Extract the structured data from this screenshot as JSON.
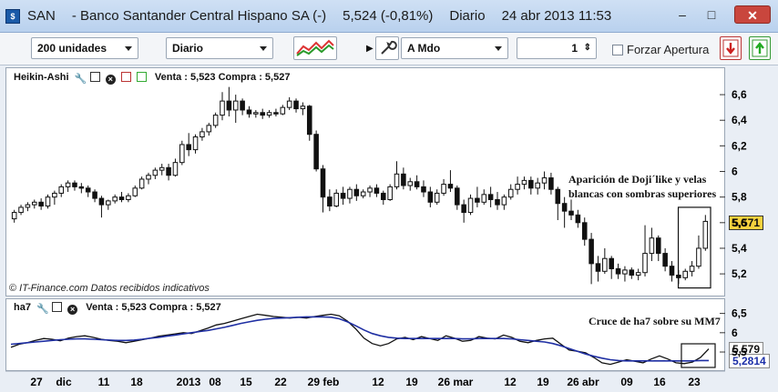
{
  "window": {
    "ticker": "SAN",
    "name": "- Banco Santander Central Hispano SA (-)",
    "price": "5,524 (-0,81%)",
    "period": "Diario",
    "datetime": "24 abr 2013 11:53",
    "minimize": "–",
    "maximize": "□",
    "close": "✕"
  },
  "toolbar": {
    "units_select": "200 unidades",
    "period_select": "Diario",
    "order_type_select": "A Mdo",
    "quantity_value": "1",
    "quantity_arrows": "⇕",
    "force_open_label": "Forzar Apertura",
    "force_open_checked": false,
    "icons": [
      "chart-style-icon",
      "wrench-icon",
      "sell-icon",
      "buy-icon"
    ]
  },
  "main_panel": {
    "title": "Heikin-Ashi",
    "quote": "Venta : 5,523 Compra : 5,527",
    "credit_prefix": "©",
    "credit_company": "IT-Finance.com",
    "credit_note": "Datos recibidos indicativos",
    "last_price_tag": "5,571",
    "annotation_line1": "Aparición de Doji´like y velas",
    "annotation_line2": "blancas con sombras superiores"
  },
  "indicator_panel": {
    "title": "ha7",
    "quote": "Venta : 5,523 Compra : 5,527",
    "tag_ha7": "5,579",
    "tag_mm7": "5,2814",
    "annotation": "Cruce de ha7 sobre su MM7"
  },
  "colors": {
    "bear_candle": "#111111",
    "bull_candle": "#ffffff",
    "ha7_line": "#111111",
    "mm7_line": "#1f2fa3",
    "last_price_bg": "#f7d23e"
  },
  "chart_data": [
    {
      "type": "candlestick",
      "title": "Heikin-Ashi",
      "yticks": [
        "6,6",
        "6,4",
        "6,2",
        "6",
        "5,8",
        "5,6",
        "5,4",
        "5,2"
      ],
      "ylim": [
        5.08,
        6.7
      ],
      "xticks": [
        "27",
        "dic",
        "11",
        "18",
        "2013",
        "08",
        "15",
        "22",
        "29 feb",
        "12",
        "19",
        "26 mar",
        "12",
        "19",
        "26 abr",
        "09",
        "16",
        "23"
      ],
      "candles": [
        {
          "o": 5.63,
          "h": 5.7,
          "l": 5.6,
          "c": 5.68
        },
        {
          "o": 5.68,
          "h": 5.74,
          "l": 5.66,
          "c": 5.72
        },
        {
          "o": 5.72,
          "h": 5.76,
          "l": 5.69,
          "c": 5.74
        },
        {
          "o": 5.74,
          "h": 5.78,
          "l": 5.71,
          "c": 5.76
        },
        {
          "o": 5.76,
          "h": 5.79,
          "l": 5.7,
          "c": 5.73
        },
        {
          "o": 5.73,
          "h": 5.82,
          "l": 5.71,
          "c": 5.8
        },
        {
          "o": 5.8,
          "h": 5.85,
          "l": 5.74,
          "c": 5.83
        },
        {
          "o": 5.83,
          "h": 5.9,
          "l": 5.8,
          "c": 5.88
        },
        {
          "o": 5.88,
          "h": 5.93,
          "l": 5.84,
          "c": 5.91
        },
        {
          "o": 5.91,
          "h": 5.93,
          "l": 5.85,
          "c": 5.88
        },
        {
          "o": 5.88,
          "h": 5.91,
          "l": 5.83,
          "c": 5.87
        },
        {
          "o": 5.87,
          "h": 5.89,
          "l": 5.8,
          "c": 5.84
        },
        {
          "o": 5.84,
          "h": 5.86,
          "l": 5.76,
          "c": 5.79
        },
        {
          "o": 5.79,
          "h": 5.81,
          "l": 5.64,
          "c": 5.74
        },
        {
          "o": 5.74,
          "h": 5.78,
          "l": 5.7,
          "c": 5.77
        },
        {
          "o": 5.77,
          "h": 5.82,
          "l": 5.75,
          "c": 5.8
        },
        {
          "o": 5.8,
          "h": 5.84,
          "l": 5.76,
          "c": 5.78
        },
        {
          "o": 5.78,
          "h": 5.83,
          "l": 5.76,
          "c": 5.81
        },
        {
          "o": 5.81,
          "h": 5.89,
          "l": 5.8,
          "c": 5.87
        },
        {
          "o": 5.87,
          "h": 5.96,
          "l": 5.86,
          "c": 5.94
        },
        {
          "o": 5.94,
          "h": 5.99,
          "l": 5.9,
          "c": 5.97
        },
        {
          "o": 5.97,
          "h": 6.03,
          "l": 5.94,
          "c": 6.01
        },
        {
          "o": 6.01,
          "h": 6.06,
          "l": 5.97,
          "c": 6.03
        },
        {
          "o": 6.03,
          "h": 6.06,
          "l": 5.93,
          "c": 5.97
        },
        {
          "o": 5.97,
          "h": 6.1,
          "l": 5.96,
          "c": 6.07
        },
        {
          "o": 6.07,
          "h": 6.24,
          "l": 6.05,
          "c": 6.21
        },
        {
          "o": 6.21,
          "h": 6.3,
          "l": 6.12,
          "c": 6.17
        },
        {
          "o": 6.17,
          "h": 6.29,
          "l": 6.14,
          "c": 6.27
        },
        {
          "o": 6.27,
          "h": 6.34,
          "l": 6.24,
          "c": 6.31
        },
        {
          "o": 6.31,
          "h": 6.38,
          "l": 6.28,
          "c": 6.36
        },
        {
          "o": 6.36,
          "h": 6.46,
          "l": 6.34,
          "c": 6.44
        },
        {
          "o": 6.44,
          "h": 6.62,
          "l": 6.4,
          "c": 6.55
        },
        {
          "o": 6.55,
          "h": 6.66,
          "l": 6.43,
          "c": 6.48
        },
        {
          "o": 6.48,
          "h": 6.6,
          "l": 6.38,
          "c": 6.55
        },
        {
          "o": 6.55,
          "h": 6.57,
          "l": 6.44,
          "c": 6.48
        },
        {
          "o": 6.48,
          "h": 6.51,
          "l": 6.42,
          "c": 6.45
        },
        {
          "o": 6.45,
          "h": 6.48,
          "l": 6.42,
          "c": 6.46
        },
        {
          "o": 6.46,
          "h": 6.49,
          "l": 6.41,
          "c": 6.44
        },
        {
          "o": 6.44,
          "h": 6.48,
          "l": 6.42,
          "c": 6.46
        },
        {
          "o": 6.46,
          "h": 6.49,
          "l": 6.43,
          "c": 6.45
        },
        {
          "o": 6.45,
          "h": 6.52,
          "l": 6.44,
          "c": 6.5
        },
        {
          "o": 6.5,
          "h": 6.58,
          "l": 6.48,
          "c": 6.55
        },
        {
          "o": 6.55,
          "h": 6.57,
          "l": 6.46,
          "c": 6.49
        },
        {
          "o": 6.49,
          "h": 6.54,
          "l": 6.44,
          "c": 6.51
        },
        {
          "o": 6.51,
          "h": 6.52,
          "l": 6.24,
          "c": 6.29
        },
        {
          "o": 6.29,
          "h": 6.32,
          "l": 6.0,
          "c": 6.02
        },
        {
          "o": 6.02,
          "h": 6.05,
          "l": 5.68,
          "c": 5.8
        },
        {
          "o": 5.8,
          "h": 5.86,
          "l": 5.69,
          "c": 5.73
        },
        {
          "o": 5.73,
          "h": 5.86,
          "l": 5.72,
          "c": 5.83
        },
        {
          "o": 5.83,
          "h": 5.88,
          "l": 5.74,
          "c": 5.79
        },
        {
          "o": 5.79,
          "h": 5.88,
          "l": 5.75,
          "c": 5.86
        },
        {
          "o": 5.86,
          "h": 5.9,
          "l": 5.77,
          "c": 5.81
        },
        {
          "o": 5.81,
          "h": 5.86,
          "l": 5.79,
          "c": 5.84
        },
        {
          "o": 5.84,
          "h": 5.89,
          "l": 5.8,
          "c": 5.87
        },
        {
          "o": 5.87,
          "h": 5.9,
          "l": 5.8,
          "c": 5.83
        },
        {
          "o": 5.83,
          "h": 5.85,
          "l": 5.74,
          "c": 5.78
        },
        {
          "o": 5.78,
          "h": 5.9,
          "l": 5.77,
          "c": 5.88
        },
        {
          "o": 5.88,
          "h": 6.08,
          "l": 5.86,
          "c": 5.98
        },
        {
          "o": 5.98,
          "h": 6.03,
          "l": 5.86,
          "c": 5.89
        },
        {
          "o": 5.89,
          "h": 5.95,
          "l": 5.85,
          "c": 5.92
        },
        {
          "o": 5.92,
          "h": 5.97,
          "l": 5.86,
          "c": 5.88
        },
        {
          "o": 5.88,
          "h": 5.93,
          "l": 5.8,
          "c": 5.84
        },
        {
          "o": 5.84,
          "h": 5.88,
          "l": 5.72,
          "c": 5.76
        },
        {
          "o": 5.76,
          "h": 5.86,
          "l": 5.74,
          "c": 5.83
        },
        {
          "o": 5.83,
          "h": 5.94,
          "l": 5.81,
          "c": 5.9
        },
        {
          "o": 5.9,
          "h": 6.01,
          "l": 5.84,
          "c": 5.87
        },
        {
          "o": 5.87,
          "h": 5.89,
          "l": 5.7,
          "c": 5.74
        },
        {
          "o": 5.74,
          "h": 5.78,
          "l": 5.6,
          "c": 5.68
        },
        {
          "o": 5.68,
          "h": 5.82,
          "l": 5.66,
          "c": 5.79
        },
        {
          "o": 5.79,
          "h": 5.88,
          "l": 5.72,
          "c": 5.76
        },
        {
          "o": 5.76,
          "h": 5.86,
          "l": 5.74,
          "c": 5.82
        },
        {
          "o": 5.82,
          "h": 5.88,
          "l": 5.72,
          "c": 5.78
        },
        {
          "o": 5.78,
          "h": 5.84,
          "l": 5.7,
          "c": 5.74
        },
        {
          "o": 5.74,
          "h": 5.82,
          "l": 5.7,
          "c": 5.8
        },
        {
          "o": 5.8,
          "h": 5.9,
          "l": 5.78,
          "c": 5.86
        },
        {
          "o": 5.86,
          "h": 5.96,
          "l": 5.82,
          "c": 5.9
        },
        {
          "o": 5.9,
          "h": 5.96,
          "l": 5.86,
          "c": 5.93
        },
        {
          "o": 5.93,
          "h": 5.96,
          "l": 5.82,
          "c": 5.87
        },
        {
          "o": 5.87,
          "h": 5.95,
          "l": 5.82,
          "c": 5.91
        },
        {
          "o": 5.91,
          "h": 6.0,
          "l": 5.86,
          "c": 5.95
        },
        {
          "o": 5.95,
          "h": 5.99,
          "l": 5.82,
          "c": 5.86
        },
        {
          "o": 5.86,
          "h": 5.88,
          "l": 5.62,
          "c": 5.75
        },
        {
          "o": 5.75,
          "h": 5.8,
          "l": 5.56,
          "c": 5.69
        },
        {
          "o": 5.69,
          "h": 5.78,
          "l": 5.62,
          "c": 5.66
        },
        {
          "o": 5.66,
          "h": 5.7,
          "l": 5.56,
          "c": 5.6
        },
        {
          "o": 5.6,
          "h": 5.64,
          "l": 5.42,
          "c": 5.47
        },
        {
          "o": 5.47,
          "h": 5.52,
          "l": 5.12,
          "c": 5.28
        },
        {
          "o": 5.28,
          "h": 5.34,
          "l": 5.14,
          "c": 5.22
        },
        {
          "o": 5.22,
          "h": 5.4,
          "l": 5.2,
          "c": 5.32
        },
        {
          "o": 5.32,
          "h": 5.34,
          "l": 5.16,
          "c": 5.24
        },
        {
          "o": 5.24,
          "h": 5.28,
          "l": 5.16,
          "c": 5.2
        },
        {
          "o": 5.2,
          "h": 5.26,
          "l": 5.14,
          "c": 5.23
        },
        {
          "o": 5.23,
          "h": 5.25,
          "l": 5.16,
          "c": 5.19
        },
        {
          "o": 5.19,
          "h": 5.24,
          "l": 5.15,
          "c": 5.21
        },
        {
          "o": 5.21,
          "h": 5.58,
          "l": 5.18,
          "c": 5.36
        },
        {
          "o": 5.36,
          "h": 5.56,
          "l": 5.3,
          "c": 5.48
        },
        {
          "o": 5.48,
          "h": 5.5,
          "l": 5.3,
          "c": 5.36
        },
        {
          "o": 5.36,
          "h": 5.4,
          "l": 5.22,
          "c": 5.26
        },
        {
          "o": 5.26,
          "h": 5.3,
          "l": 5.14,
          "c": 5.19
        },
        {
          "o": 5.19,
          "h": 5.23,
          "l": 5.12,
          "c": 5.17
        },
        {
          "o": 5.17,
          "h": 5.24,
          "l": 5.15,
          "c": 5.22
        },
        {
          "o": 5.22,
          "h": 5.3,
          "l": 5.18,
          "c": 5.26
        },
        {
          "o": 5.26,
          "h": 5.5,
          "l": 5.24,
          "c": 5.4
        },
        {
          "o": 5.4,
          "h": 5.66,
          "l": 5.38,
          "c": 5.61
        }
      ]
    },
    {
      "type": "line",
      "title": "ha7",
      "yticks": [
        "6,5",
        "6",
        "5,5"
      ],
      "ylim": [
        5.1,
        6.75
      ],
      "series": [
        {
          "name": "ha7",
          "values": [
            5.62,
            5.7,
            5.74,
            5.8,
            5.85,
            5.83,
            5.79,
            5.86,
            5.9,
            5.92,
            5.88,
            5.83,
            5.8,
            5.78,
            5.74,
            5.78,
            5.82,
            5.86,
            5.91,
            5.94,
            5.97,
            6.0,
            5.98,
            6.05,
            6.12,
            6.2,
            6.24,
            6.3,
            6.36,
            6.42,
            6.48,
            6.45,
            6.42,
            6.4,
            6.38,
            6.4,
            6.38,
            6.42,
            6.45,
            6.48,
            6.44,
            6.3,
            6.1,
            5.86,
            5.72,
            5.66,
            5.72,
            5.84,
            5.88,
            5.82,
            5.9,
            5.85,
            5.8,
            5.92,
            5.86,
            5.78,
            5.8,
            5.9,
            5.86,
            5.84,
            5.94,
            5.88,
            5.78,
            5.74,
            5.8,
            5.84,
            5.86,
            5.7,
            5.55,
            5.52,
            5.48,
            5.36,
            5.22,
            5.18,
            5.24,
            5.3,
            5.26,
            5.22,
            5.32,
            5.4,
            5.32,
            5.22,
            5.2,
            5.24,
            5.36,
            5.58
          ]
        },
        {
          "name": "MM7",
          "values": [
            5.7,
            5.72,
            5.74,
            5.76,
            5.78,
            5.8,
            5.82,
            5.83,
            5.84,
            5.84,
            5.83,
            5.82,
            5.81,
            5.8,
            5.8,
            5.81,
            5.83,
            5.86,
            5.88,
            5.91,
            5.94,
            5.97,
            6.0,
            6.03,
            6.06,
            6.1,
            6.14,
            6.19,
            6.24,
            6.28,
            6.32,
            6.35,
            6.37,
            6.38,
            6.39,
            6.4,
            6.41,
            6.41,
            6.41,
            6.4,
            6.36,
            6.28,
            6.18,
            6.07,
            5.98,
            5.92,
            5.88,
            5.86,
            5.85,
            5.85,
            5.85,
            5.85,
            5.85,
            5.85,
            5.85,
            5.84,
            5.84,
            5.85,
            5.85,
            5.85,
            5.85,
            5.84,
            5.82,
            5.8,
            5.78,
            5.76,
            5.72,
            5.66,
            5.59,
            5.52,
            5.45,
            5.39,
            5.34,
            5.3,
            5.28,
            5.27,
            5.27,
            5.27,
            5.27,
            5.27,
            5.27,
            5.27,
            5.27,
            5.27,
            5.28,
            5.28
          ]
        }
      ]
    }
  ]
}
